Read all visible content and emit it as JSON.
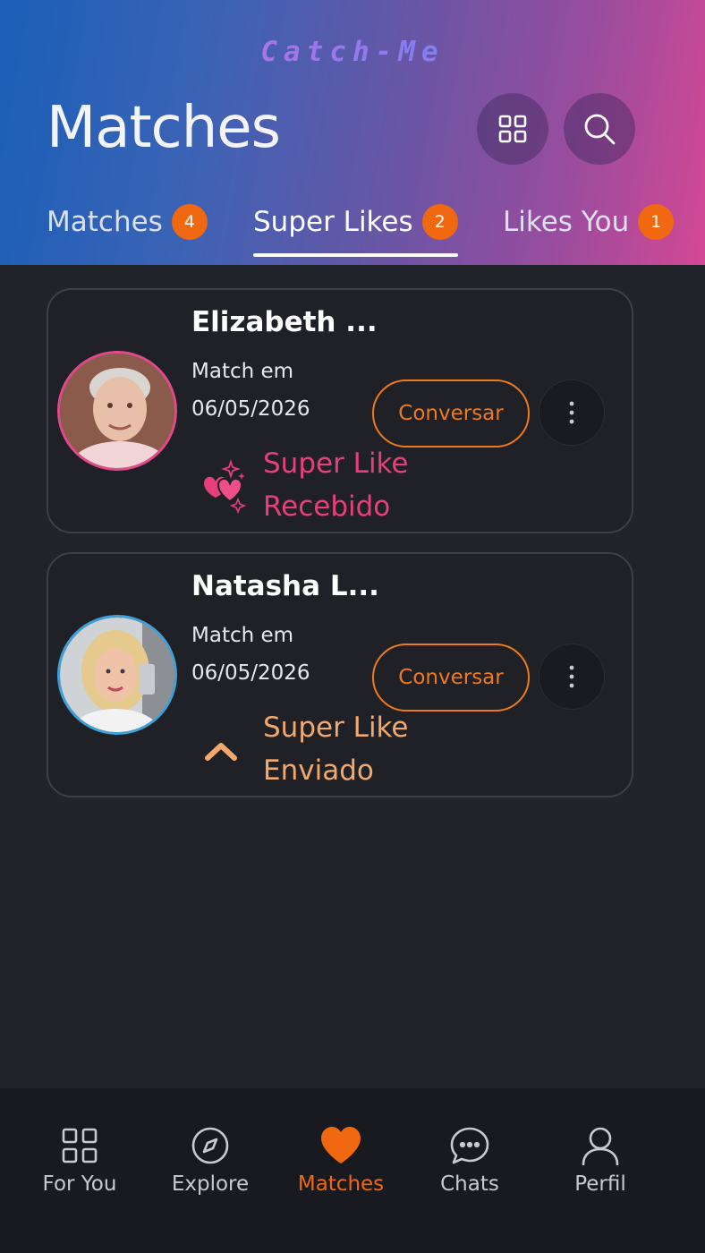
{
  "header": {
    "brand": "Catch-Me",
    "title": "Matches",
    "colors": {
      "gradient_start": "#1a5fb8",
      "gradient_end": "#d44894"
    }
  },
  "tabs": [
    {
      "label": "Matches",
      "badge": "4",
      "active": false
    },
    {
      "label": "Super Likes",
      "badge": "2",
      "active": true
    },
    {
      "label": "Likes You",
      "badge": "1",
      "active": false
    }
  ],
  "cards": [
    {
      "name": "Elizabeth ...",
      "match_label": "Match em",
      "match_date": "06/05/2026",
      "button": "Conversar",
      "status_line1": "Super Like",
      "status_line2": "Recebido",
      "status_icon": "hearts-sparkle-icon",
      "status_color": "#e6407a"
    },
    {
      "name": "Natasha L...",
      "match_label": "Match em",
      "match_date": "06/05/2026",
      "button": "Conversar",
      "status_line1": "Super Like",
      "status_line2": "Enviado",
      "status_icon": "chevron-up-icon",
      "status_color": "#f2a96e"
    }
  ],
  "bottom_nav": [
    {
      "label": "For You",
      "icon": "grid-icon",
      "active": false
    },
    {
      "label": "Explore",
      "icon": "compass-icon",
      "active": false
    },
    {
      "label": "Matches",
      "icon": "heart-icon",
      "active": true
    },
    {
      "label": "Chats",
      "icon": "chat-bubble-icon",
      "active": false
    },
    {
      "label": "Perfil",
      "icon": "user-icon",
      "active": false
    }
  ],
  "accent_color": "#f0680f"
}
